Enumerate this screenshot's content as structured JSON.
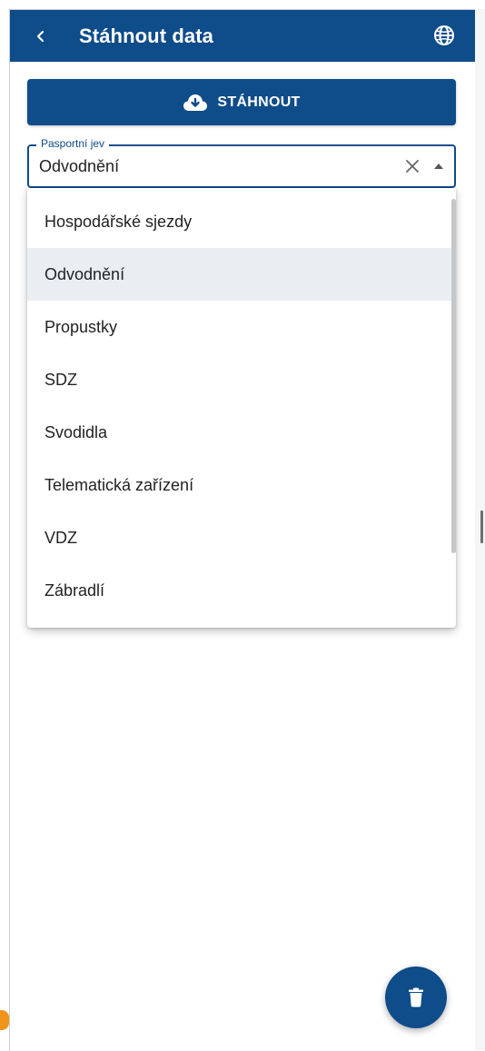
{
  "header": {
    "title": "Stáhnout data"
  },
  "download": {
    "label": "STÁHNOUT"
  },
  "field": {
    "legend": "Pasportní jev",
    "value": "Odvodnění"
  },
  "dropdown": {
    "options": [
      {
        "label": "Hospodářské sjezdy"
      },
      {
        "label": "Odvodnění"
      },
      {
        "label": "Propustky"
      },
      {
        "label": "SDZ"
      },
      {
        "label": "Svodidla"
      },
      {
        "label": "Telematická zařízení"
      },
      {
        "label": "VDZ"
      },
      {
        "label": "Zábradlí"
      }
    ],
    "selected": "Odvodnění"
  },
  "colors": {
    "primary": "#0f4c8a",
    "selected_row": "#e9eef3",
    "logo_fragment": "#f0941c"
  },
  "icons": {
    "back": "chevron-left-icon",
    "globe": "globe-icon",
    "download": "cloud-download-icon",
    "clear": "close-icon",
    "dropdown_toggle": "caret-up-icon",
    "delete": "trash-icon"
  }
}
